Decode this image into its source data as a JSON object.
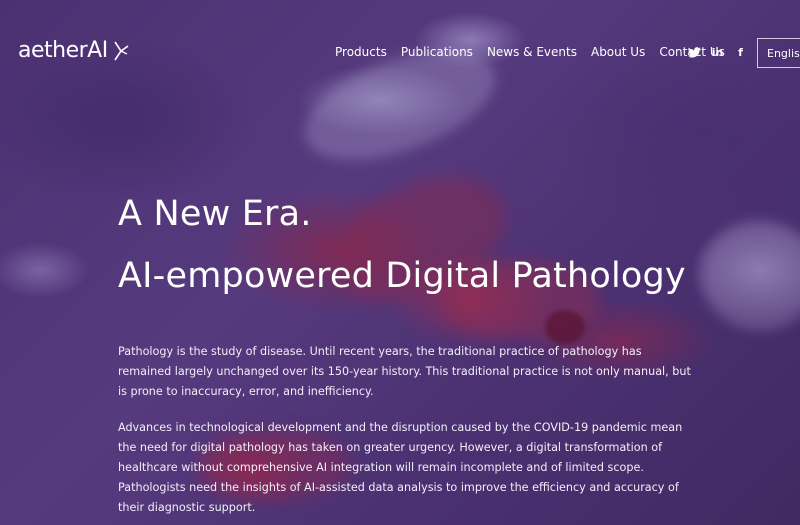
{
  "header": {
    "logo_text": "aetherAI",
    "nav": [
      {
        "label": "Products"
      },
      {
        "label": "Publications"
      },
      {
        "label": "News & Events"
      },
      {
        "label": "About Us"
      },
      {
        "label": "Contact Us"
      }
    ],
    "social": [
      {
        "icon": "twitter-icon"
      },
      {
        "icon": "linkedin-icon",
        "glyph": "in"
      },
      {
        "icon": "facebook-icon",
        "glyph": "f"
      }
    ],
    "language_button": "English"
  },
  "hero": {
    "headline_line1": "A New Era.",
    "headline_line2": "AI-empowered Digital Pathology",
    "paragraph1": "Pathology is the study of disease. Until recent years, the traditional practice of pathology has remained largely unchanged over its 150-year history. This traditional practice is not only manual, but is prone to inaccuracy, error, and inefficiency.",
    "paragraph2": "Advances in technological development and the disruption caused by the COVID-19 pandemic mean the need for digital pathology has taken on greater urgency. However, a digital transformation of healthcare without comprehensive AI integration will remain incomplete and of limited scope. Pathologists need the insights of AI-assisted data analysis to improve the efficiency and accuracy of their diagnostic support."
  },
  "colors": {
    "background": "#4a3270",
    "text": "#ffffff",
    "tissue_highlight": "#8a2a55"
  }
}
